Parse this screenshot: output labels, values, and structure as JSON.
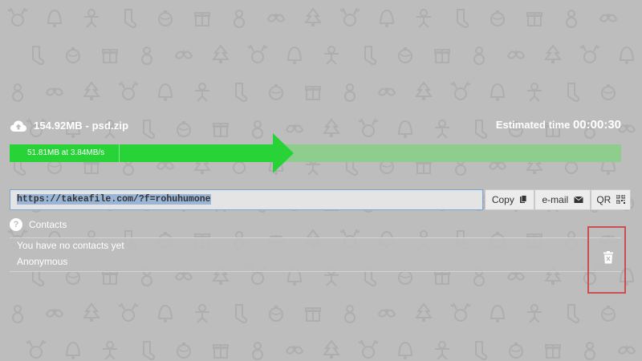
{
  "file": {
    "name": "154.92MB - psd.zip",
    "icon": "cloud-upload-icon"
  },
  "eta": {
    "label": "Estimated time",
    "value": "00:00:30"
  },
  "progress": {
    "text": "51.81MB at 3.84MB/s",
    "fraction": 0.43,
    "fill_color": "#28d338",
    "track_color": "#8fcd8f"
  },
  "link": {
    "url": "https://takeafile.com/?f=rohuhumone"
  },
  "buttons": {
    "copy": {
      "label": "Copy",
      "icon": "clipboard-icon"
    },
    "email": {
      "label": "e-mail",
      "icon": "envelope-icon"
    },
    "qr": {
      "label": "QR",
      "icon": "qr-code-icon"
    }
  },
  "contacts": {
    "label": "Contacts",
    "help_icon": "question-icon",
    "empty_text": "You have no contacts yet",
    "entry": "Anonymous",
    "delete_icon": "trash-icon",
    "highlight_color": "#cc4e4e"
  },
  "background": {
    "color": "#bdbdbd",
    "pattern_icons": [
      "reindeer-icon",
      "bell-icon",
      "gingerbread-icon",
      "stocking-icon",
      "ornament-icon",
      "gift-icon",
      "snowman-icon",
      "holly-icon",
      "tree-icon"
    ]
  }
}
